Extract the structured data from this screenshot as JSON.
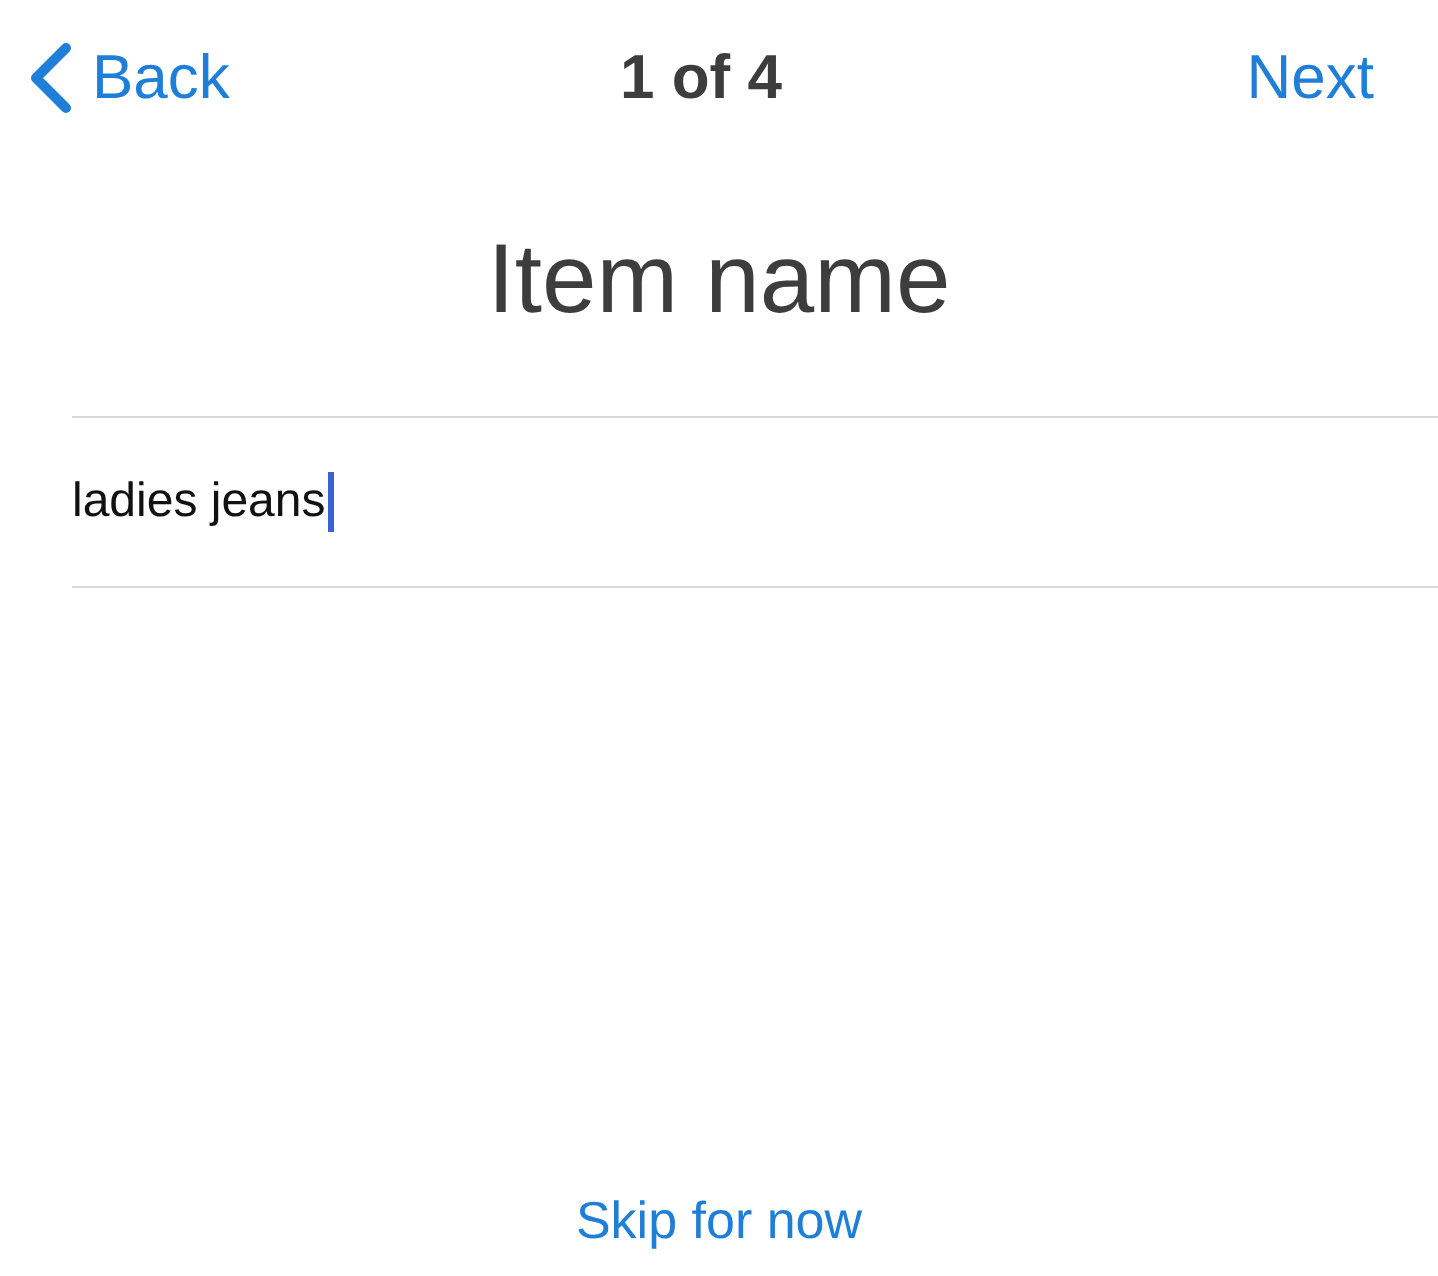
{
  "nav": {
    "back": "Back",
    "title": "1 of 4",
    "next": "Next"
  },
  "heading": "Item name",
  "field": {
    "value": "ladies jeans",
    "focused": true
  },
  "skip": "Skip for now"
}
